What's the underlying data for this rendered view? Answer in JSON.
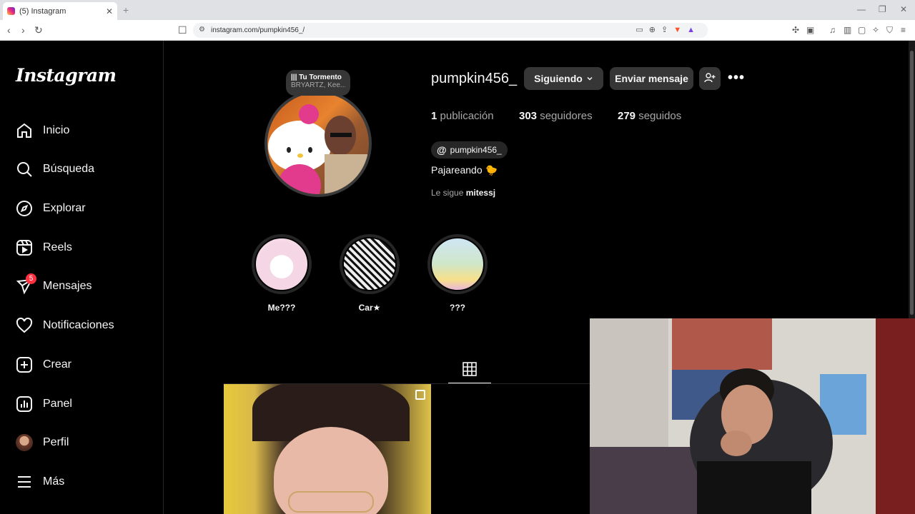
{
  "browser": {
    "tab_title": "(5) Instagram",
    "url": "instagram.com/pumpkin456_/",
    "new_tab": "+",
    "close_tab": "✕"
  },
  "sidebar": {
    "logo": "Instagram",
    "items": [
      {
        "label": "Inicio",
        "icon": "home-icon"
      },
      {
        "label": "Búsqueda",
        "icon": "search-icon"
      },
      {
        "label": "Explorar",
        "icon": "compass-icon"
      },
      {
        "label": "Reels",
        "icon": "reels-icon"
      },
      {
        "label": "Mensajes",
        "icon": "messenger-icon",
        "badge": "5"
      },
      {
        "label": "Notificaciones",
        "icon": "heart-icon"
      },
      {
        "label": "Crear",
        "icon": "plus-square-icon"
      },
      {
        "label": "Panel",
        "icon": "dashboard-icon"
      },
      {
        "label": "Perfil",
        "icon": "avatar"
      },
      {
        "label": "Más",
        "icon": "menu-icon"
      }
    ]
  },
  "profile": {
    "note_title": "Tu Tormento",
    "note_sub": "BRYARTZ, Kee...",
    "username": "pumpkin456_",
    "following_button": "Siguiendo",
    "message_button": "Enviar mensaje",
    "posts_count": "1",
    "posts_label": "publicación",
    "followers_count": "303",
    "followers_label": "seguidores",
    "following_count": "279",
    "following_label": "seguidos",
    "threads_handle": "pumpkin456_",
    "bio": "Pajareando 🐤",
    "followed_by_prefix": "Le sigue",
    "followed_by_user": "mitessj"
  },
  "highlights": [
    {
      "label": "Me???",
      "color": "#f4d6e4"
    },
    {
      "label": "Car★",
      "color": "#d9d9d9"
    },
    {
      "label": "???",
      "color": "#cfe6c8"
    }
  ],
  "colors": {
    "background": "#000000",
    "button_bg": "#363636",
    "secondary_text": "#a8a8a8",
    "badge": "#ff3040"
  }
}
